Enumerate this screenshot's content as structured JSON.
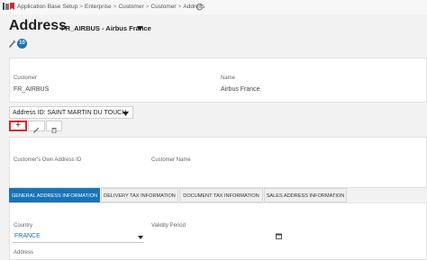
{
  "breadcrumb": {
    "items": [
      "Application Base Setup",
      "Enterprise",
      "Customer",
      "Customer",
      "Address"
    ],
    "separator": ">"
  },
  "header": {
    "title": "Address",
    "subtitle": "FR_AIRBUS - Airbus France",
    "badge_count": "10"
  },
  "customer_panel": {
    "customer_label": "Customer",
    "customer_value": "FR_AIRBUS",
    "name_label": "Name",
    "name_value": "Airbus France"
  },
  "address_selector": {
    "value": "Address ID: SAINT MARTIN DU TOUCH"
  },
  "toolbar": {
    "add_symbol": "+"
  },
  "address_panel": {
    "own_id_label": "Customer's Own Address ID",
    "customer_name_label": "Customer Name"
  },
  "tabs": [
    "GENERAL ADDRESS INFORMATION",
    "DELIVERY TAX INFORMATION",
    "DOCUMENT TAX INFORMATION",
    "SALES ADDRESS INFORMATION"
  ],
  "general": {
    "country_label": "Country",
    "country_value": "FRANCE",
    "validity_label": "Validity Period",
    "address_label": "Address"
  },
  "colors": {
    "accent": "#1a73b8",
    "highlight_border": "#d9262b"
  }
}
